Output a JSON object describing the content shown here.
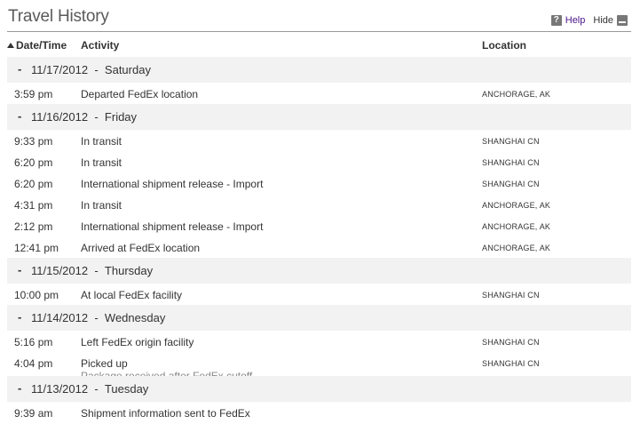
{
  "header": {
    "title": "Travel History",
    "help_label": "Help",
    "hide_label": "Hide",
    "help_icon_glyph": "?"
  },
  "columns": {
    "date_time": "Date/Time",
    "activity": "Activity",
    "location": "Location"
  },
  "groups": [
    {
      "dash": "-",
      "date": "11/17/2012",
      "sep": "-",
      "day": "Saturday",
      "events": [
        {
          "time": "3:59 pm",
          "activity": "Departed FedEx location",
          "location": "ANCHORAGE, AK"
        }
      ]
    },
    {
      "dash": "-",
      "date": "11/16/2012",
      "sep": "-",
      "day": "Friday",
      "events": [
        {
          "time": "9:33 pm",
          "activity": "In transit",
          "location": "SHANGHAI CN"
        },
        {
          "time": "6:20 pm",
          "activity": "In transit",
          "location": "SHANGHAI CN"
        },
        {
          "time": "6:20 pm",
          "activity": "International shipment release - Import",
          "location": "SHANGHAI CN"
        },
        {
          "time": "4:31 pm",
          "activity": "In transit",
          "location": "ANCHORAGE, AK"
        },
        {
          "time": "2:12 pm",
          "activity": "International shipment release - Import",
          "location": "ANCHORAGE, AK"
        },
        {
          "time": "12:41 pm",
          "activity": "Arrived at FedEx location",
          "location": "ANCHORAGE, AK"
        }
      ]
    },
    {
      "dash": "-",
      "date": "11/15/2012",
      "sep": "-",
      "day": "Thursday",
      "events": [
        {
          "time": "10:00 pm",
          "activity": "At local FedEx facility",
          "location": "SHANGHAI CN"
        }
      ]
    },
    {
      "dash": "-",
      "date": "11/14/2012",
      "sep": "-",
      "day": "Wednesday",
      "events": [
        {
          "time": "5:16 pm",
          "activity": "Left FedEx origin facility",
          "location": "SHANGHAI CN"
        },
        {
          "time": "4:04 pm",
          "activity": "Picked up",
          "detail": "Package received after FedEx cutoff",
          "location": "SHANGHAI CN"
        }
      ]
    },
    {
      "dash": "-",
      "date": "11/13/2012",
      "sep": "-",
      "day": "Tuesday",
      "events": [
        {
          "time": "9:39 am",
          "activity": "Shipment information sent to FedEx",
          "location": ""
        }
      ]
    }
  ]
}
